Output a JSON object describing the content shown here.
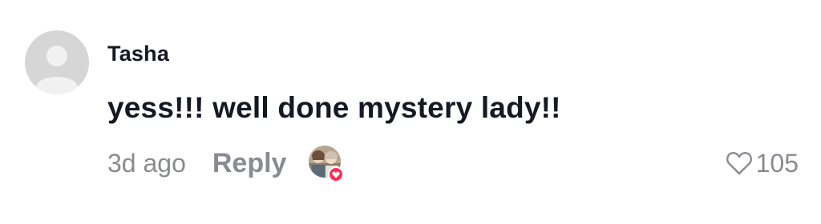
{
  "comment": {
    "username": "Tasha",
    "text": "yess!!! well done mystery lady!!",
    "timestamp": "3d ago",
    "reply_label": "Reply",
    "like_count": "105",
    "avatar_icon": "default-avatar-icon",
    "creator_liked_icon": "creator-liked-avatar-icon",
    "like_icon": "heart-outline-icon"
  },
  "colors": {
    "text_primary": "#161823",
    "text_secondary": "#8a8b91",
    "avatar_placeholder": "#d6d6d6",
    "heart_badge": "#fe2c55"
  }
}
